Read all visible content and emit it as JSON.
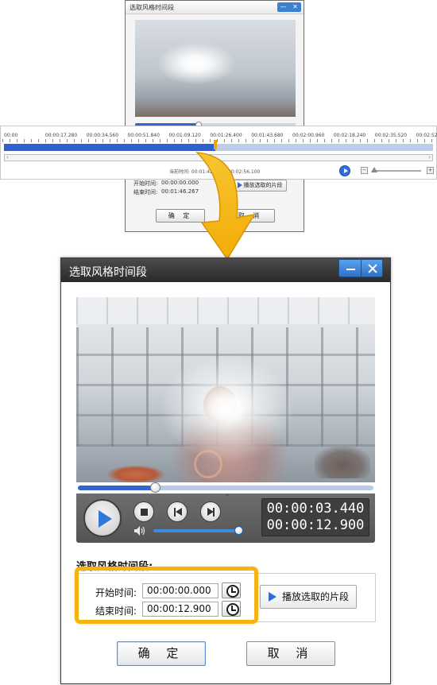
{
  "mini_dialog": {
    "title": "选取风格时间段",
    "win_min": "—",
    "win_close": "✕",
    "start_label": "开始时间:",
    "start_value": "00:00:00.000",
    "end_label": "结束时间:",
    "end_value": "00:01:46.267",
    "play_selection_label": "播放选取的片段",
    "ok_label": "确 定",
    "cancel_label": "取 消"
  },
  "timeline": {
    "ticks": [
      "00:00",
      "00:00:17.280",
      "00:00:34.560",
      "00:00:51.840",
      "00:01:09.120",
      "00:01:26.400",
      "00:01:43.680",
      "00:02:00.960",
      "00:02:18.240",
      "00:02:35.520",
      "00:02:52."
    ],
    "current_time_text": "当前时间: 00:01:42.480 / 00:02:56.100",
    "progress_fraction": 0.49,
    "zoom_minus": "−",
    "zoom_plus": "+"
  },
  "dialog": {
    "title": "选取风格时间段",
    "seek_progress_fraction": 0.26,
    "volume_fraction": 1.0,
    "current_time": "00:00:03.440",
    "total_time": "00:00:12.900",
    "section_label": "选取风格时间段:",
    "start_label": "开始时间:",
    "start_value": "00:00:00.000",
    "end_label": "结束时间:",
    "end_value": "00:00:12.900",
    "play_selection_label": "播放选取的片段",
    "ok_label": "确 定",
    "cancel_label": "取 消"
  },
  "icons": {
    "minimize": "minimize-icon",
    "close": "close-icon",
    "play": "play-icon",
    "stop": "stop-icon",
    "prev_frame": "previous-frame-icon",
    "next_frame": "next-frame-icon",
    "volume": "volume-icon",
    "clock": "clock-icon",
    "arrow": "down-arrow-icon"
  },
  "colors": {
    "accent_blue": "#2f6fd6",
    "highlight_orange": "#f4b313",
    "titlebar_dark": "#333333"
  }
}
